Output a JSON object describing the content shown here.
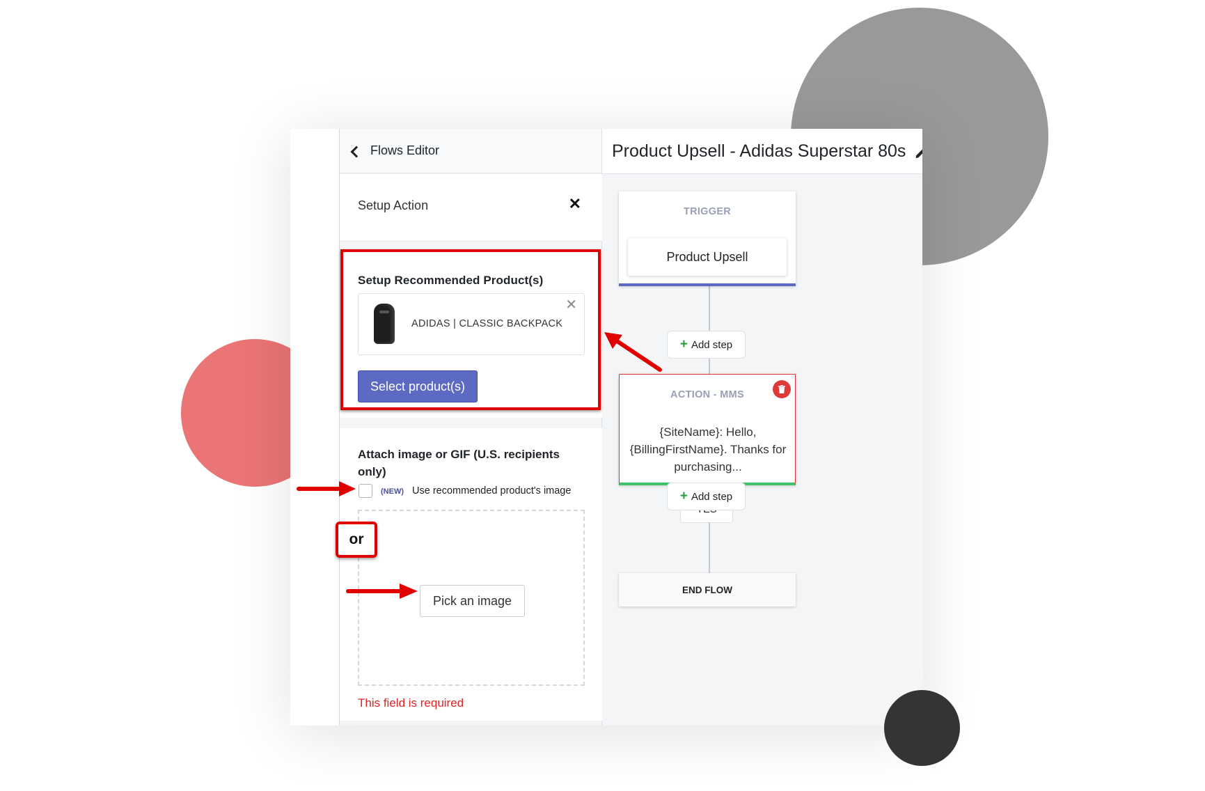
{
  "panel": {
    "back_label": "Flows Editor",
    "setup_action_label": "Setup Action",
    "recommended": {
      "title": "Setup Recommended Product(s)",
      "product_name": "ADIDAS | CLASSIC BACKPACK",
      "select_button": "Select product(s)"
    },
    "attach": {
      "title": "Attach image or GIF (U.S. recipients only)",
      "new_tag": "(NEW)",
      "checkbox_label": "Use recommended product's image",
      "checkbox_checked": false,
      "pick_button": "Pick an image",
      "error": "This field is required"
    }
  },
  "canvas": {
    "flow_title": "Product Upsell - Adidas Superstar 80s",
    "trigger": {
      "caption": "TRIGGER",
      "name": "Product Upsell"
    },
    "add_step_label": "Add step",
    "action": {
      "caption": "ACTION - MMS",
      "text": "{SiteName}: Hello, {BillingFirstName}. Thanks for purchasing..."
    },
    "yes_label": "YES",
    "end_label": "END FLOW"
  },
  "annotations": {
    "or_label": "or"
  },
  "colors": {
    "primary": "#5c6ac4",
    "danger": "#e02424",
    "annotation_red": "#e00000",
    "success": "#3ec26a",
    "circle_gray": "#999999",
    "circle_red": "#eb7474",
    "circle_dark": "#343434"
  }
}
